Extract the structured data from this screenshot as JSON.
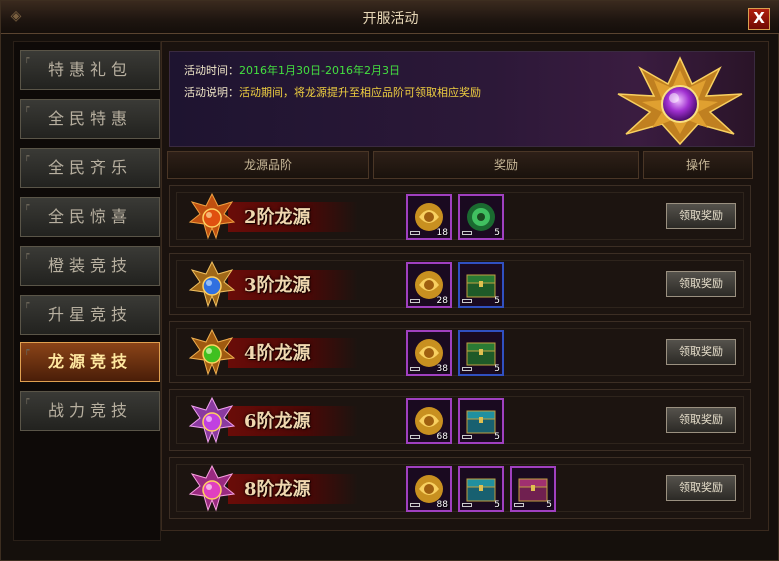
{
  "window": {
    "title": "开服活动",
    "close": "X"
  },
  "sidebar": {
    "items": [
      {
        "label": "特惠礼包",
        "active": false
      },
      {
        "label": "全民特惠",
        "active": false
      },
      {
        "label": "全民齐乐",
        "active": false
      },
      {
        "label": "全民惊喜",
        "active": false
      },
      {
        "label": "橙装竞技",
        "active": false
      },
      {
        "label": "升星竞技",
        "active": false
      },
      {
        "label": "龙源竞技",
        "active": true
      },
      {
        "label": "战力竞技",
        "active": false
      }
    ]
  },
  "banner": {
    "time_label": "活动时间：",
    "time_value": "2016年1月30日-2016年2月3日",
    "desc_label": "活动说明：",
    "desc_value": "活动期间，将龙源提升至相应品阶可领取相应奖励"
  },
  "columns": {
    "tier": "龙源品阶",
    "reward": "奖励",
    "action": "操作"
  },
  "rows": [
    {
      "stage": "2阶龙源",
      "emblem_color": "#e05010",
      "rewards": [
        {
          "icon": "gold-dragon-orb-icon",
          "count": "18"
        },
        {
          "icon": "green-jade-icon",
          "count": "5"
        }
      ],
      "button": "领取奖励"
    },
    {
      "stage": "3阶龙源",
      "emblem_color": "#3070e0",
      "rewards": [
        {
          "icon": "gold-dragon-orb-icon",
          "count": "28"
        },
        {
          "icon": "green-chest-icon",
          "count": "5"
        }
      ],
      "button": "领取奖励"
    },
    {
      "stage": "4阶龙源",
      "emblem_color": "#40c020",
      "rewards": [
        {
          "icon": "gold-dragon-orb-icon",
          "count": "38"
        },
        {
          "icon": "green-chest-icon",
          "count": "5"
        }
      ],
      "button": "领取奖励"
    },
    {
      "stage": "6阶龙源",
      "emblem_color": "#c040e0",
      "rewards": [
        {
          "icon": "gold-dragon-orb-icon",
          "count": "68"
        },
        {
          "icon": "teal-chest-icon",
          "count": "5"
        }
      ],
      "button": "领取奖励"
    },
    {
      "stage": "8阶龙源",
      "emblem_color": "#e040c0",
      "rewards": [
        {
          "icon": "gold-dragon-orb-icon",
          "count": "88"
        },
        {
          "icon": "teal-chest-icon",
          "count": "5"
        },
        {
          "icon": "pink-chest-icon",
          "count": "5"
        }
      ],
      "button": "领取奖励"
    }
  ]
}
